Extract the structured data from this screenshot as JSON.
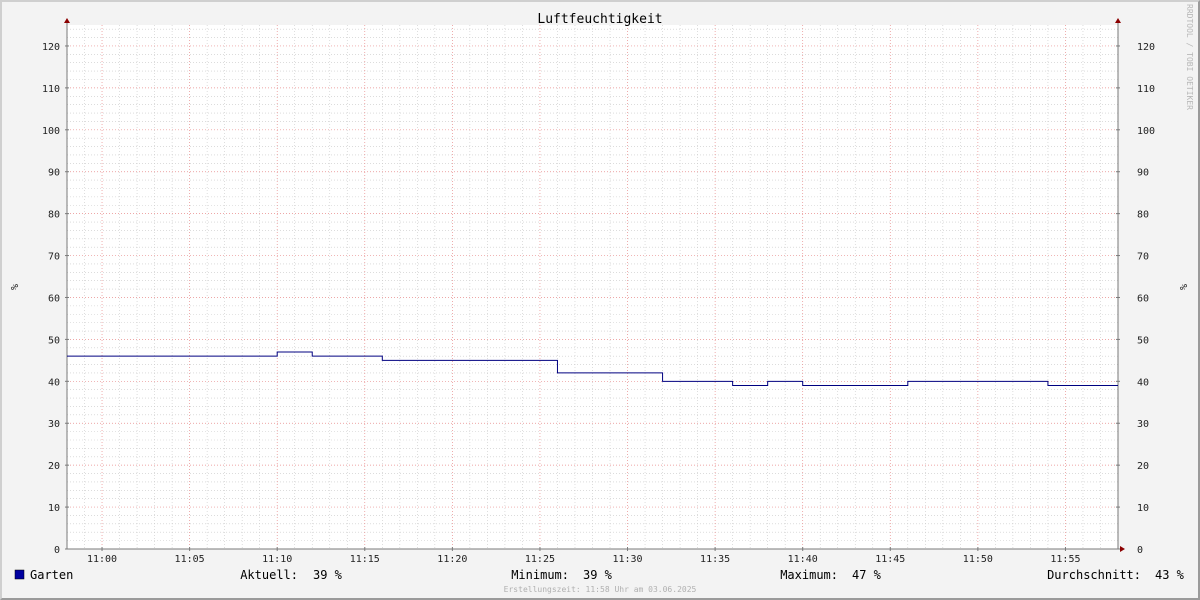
{
  "chart_data": {
    "type": "line",
    "title": "Luftfeuchtigkeit",
    "ylabel": "%",
    "ylim": [
      0,
      125
    ],
    "yticks": [
      0,
      10,
      20,
      30,
      40,
      50,
      60,
      70,
      80,
      90,
      100,
      110,
      120
    ],
    "xlim": [
      "10:58",
      "11:58"
    ],
    "xticks": [
      "11:00",
      "11:05",
      "11:10",
      "11:15",
      "11:20",
      "11:25",
      "11:30",
      "11:35",
      "11:40",
      "11:45",
      "11:50",
      "11:55"
    ],
    "grid": true,
    "series": [
      {
        "name": "Garten",
        "color": "#000080",
        "x": [
          "10:58",
          "11:10",
          "11:12",
          "11:16",
          "11:26",
          "11:32",
          "11:36",
          "11:38",
          "11:40",
          "11:46",
          "11:54",
          "11:58"
        ],
        "values": [
          46,
          47,
          46,
          45,
          42,
          40,
          39,
          40,
          39,
          40,
          39,
          39
        ]
      }
    ]
  },
  "legend": {
    "series_name": "Garten",
    "swatch_color": "#0000a0",
    "current_label": "Aktuell:",
    "current_value": "39 %",
    "min_label": "Minimum:",
    "min_value": "39 %",
    "max_label": "Maximum:",
    "max_value": "47 %",
    "avg_label": "Durchschnitt:",
    "avg_value": "43 %"
  },
  "footer": "Erstellungszeit: 11:58 Uhr am 03.06.2025",
  "watermark": "RRDTOOL / TOBI OETIKER",
  "colors": {
    "background": "#f3f3f3",
    "canvas": "#ffffff",
    "major_grid": "#e88a8a",
    "minor_grid": "#c8c8c8",
    "axis": "#7a7a7a",
    "arrow": "#8b0000",
    "line": "#000080"
  }
}
